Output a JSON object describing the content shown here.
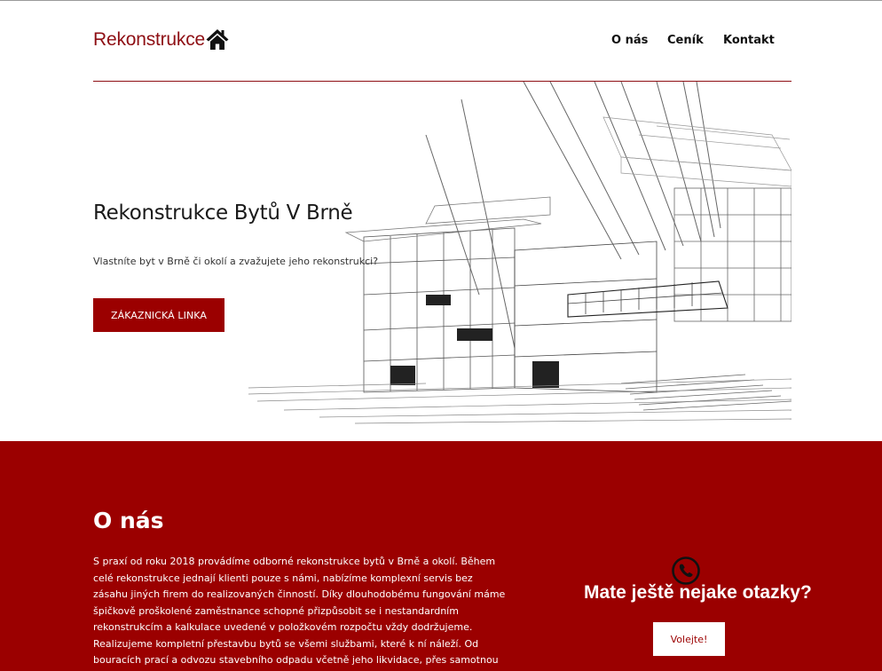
{
  "header": {
    "logo_text": "Rekonstrukce",
    "logo_icon": "house-icon",
    "nav": [
      "O nás",
      "Ceník",
      "Kontakt"
    ]
  },
  "hero": {
    "title": "Rekonstrukce Bytů V Brně",
    "subtitle": "Vlastníte byt v Brně či okolí a zvažujete jeho rekonstrukci?",
    "button_label": "ZÁKAZNICKÁ LINKA"
  },
  "about": {
    "title": "O nás",
    "text": "S praxí od roku 2018 provádíme odborné rekonstrukce bytů v Brně a okolí. Během celé rekonstrukce jednají klienti pouze s námi, nabízíme komplexní servis bez zásahu jiných firem do realizovaných činností. Díky dlouhodobému fungování máme špičkově proškolené zaměstnance schopné přizpůsobit se i nestandardním rekonstrukcím a kalkulace uvedené v položkovém rozpočtu vždy dodržujeme. Realizujeme kompletní přestavbu bytů se všemi službami, které k ní náleží. Od bouracích prací a odvozu stavebního odpadu včetně jeho likvidace, přes samotnou rekonstrukci až po závěrečné předání díla včetně všech potřebných protokolů a",
    "question": "Mate ještě nejake otazky?",
    "question_button": "Volejte!",
    "phone_icon": "phone-icon"
  },
  "colors": {
    "brand": "#9b0000",
    "logo": "#8e0f14"
  }
}
